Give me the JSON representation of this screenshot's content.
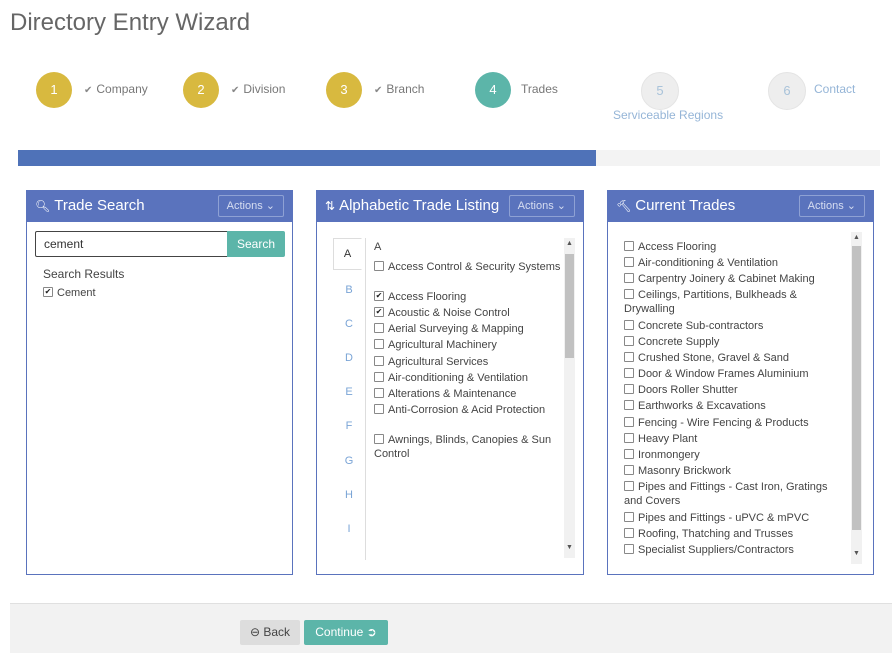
{
  "page": {
    "title": "Directory Entry Wizard"
  },
  "steps": [
    {
      "number": "1",
      "label": "Company",
      "state": "done"
    },
    {
      "number": "2",
      "label": "Division",
      "state": "done"
    },
    {
      "number": "3",
      "label": "Branch",
      "state": "done"
    },
    {
      "number": "4",
      "label": "Trades",
      "state": "active"
    },
    {
      "number": "5",
      "label": "Serviceable Regions",
      "state": "todo"
    },
    {
      "number": "6",
      "label": "Contact",
      "state": "todo"
    }
  ],
  "progress": {
    "percent": 67,
    "color": "#4f72b8"
  },
  "colors": {
    "gold": "#d8b93f",
    "teal": "#5cb5a9",
    "panel_header": "#5a73bd"
  },
  "trade_search": {
    "title": "Trade Search",
    "icon": "search-icon",
    "actions_label": "Actions",
    "input_value": "cement",
    "button_label": "Search",
    "results_title": "Search Results",
    "results": [
      {
        "label": "Cement",
        "checked": true
      }
    ]
  },
  "alpha_listing": {
    "title": "Alphabetic Trade Listing",
    "icon": "sort-alpha-icon",
    "actions_label": "Actions",
    "letters": [
      "A",
      "B",
      "C",
      "D",
      "E",
      "F",
      "G",
      "H",
      "I"
    ],
    "active_letter": "A",
    "group_heading": "A",
    "items": [
      {
        "label": "Access Control & Security Systems",
        "checked": false
      },
      {
        "label": "Access Flooring",
        "checked": true
      },
      {
        "label": "Acoustic & Noise Control",
        "checked": true
      },
      {
        "label": "Aerial Surveying & Mapping",
        "checked": false
      },
      {
        "label": "Agricultural Machinery",
        "checked": false
      },
      {
        "label": "Agricultural Services",
        "checked": false
      },
      {
        "label": "Air-conditioning & Ventilation",
        "checked": false
      },
      {
        "label": "Alterations & Maintenance",
        "checked": false
      },
      {
        "label": "Anti-Corrosion & Acid Protection",
        "checked": false
      },
      {
        "label": "Awnings, Blinds, Canopies & Sun Control",
        "checked": false
      }
    ]
  },
  "current_trades": {
    "title": "Current Trades",
    "icon": "gavel-icon",
    "actions_label": "Actions",
    "items": [
      {
        "label": "Access Flooring",
        "checked": false
      },
      {
        "label": "Air-conditioning & Ventilation",
        "checked": false
      },
      {
        "label": "Carpentry Joinery & Cabinet Making",
        "checked": false
      },
      {
        "label": "Ceilings, Partitions, Bulkheads & Drywalling",
        "checked": false
      },
      {
        "label": "Concrete Sub-contractors",
        "checked": false
      },
      {
        "label": "Concrete Supply",
        "checked": false
      },
      {
        "label": "Crushed Stone, Gravel & Sand",
        "checked": false
      },
      {
        "label": "Door & Window Frames Aluminium",
        "checked": false
      },
      {
        "label": "Doors Roller Shutter",
        "checked": false
      },
      {
        "label": "Earthworks & Excavations",
        "checked": false
      },
      {
        "label": "Fencing - Wire Fencing & Products",
        "checked": false
      },
      {
        "label": "Heavy Plant",
        "checked": false
      },
      {
        "label": "Ironmongery",
        "checked": false
      },
      {
        "label": "Masonry Brickwork",
        "checked": false
      },
      {
        "label": "Pipes and Fittings - Cast Iron, Gratings and Covers",
        "checked": false
      },
      {
        "label": "Pipes and Fittings - uPVC & mPVC",
        "checked": false
      },
      {
        "label": "Roofing, Thatching and Trusses",
        "checked": false
      },
      {
        "label": "Specialist Suppliers/Contractors",
        "checked": false
      }
    ]
  },
  "footer": {
    "back_label": "Back",
    "continue_label": "Continue"
  }
}
